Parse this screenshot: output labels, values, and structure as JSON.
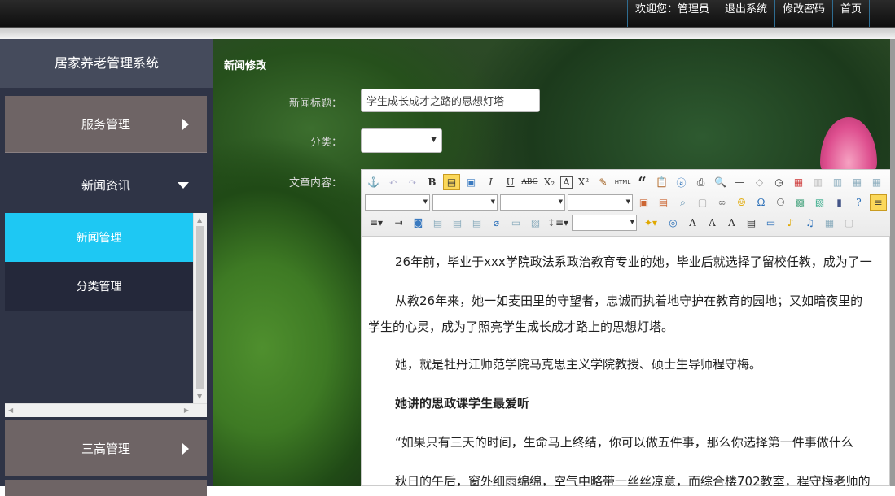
{
  "topnav": {
    "welcome": "欢迎您：管理员",
    "logout": "退出系统",
    "change_password": "修改密码",
    "home": "首页"
  },
  "sidebar": {
    "system_title": "居家养老管理系统",
    "menu": {
      "service": "服务管理",
      "news": "新闻资讯",
      "sanggao": "三高管理"
    },
    "submenu": {
      "news_manage": "新闻管理",
      "category_manage": "分类管理"
    }
  },
  "page": {
    "heading": "新闻修改"
  },
  "form": {
    "title_label": "新闻标题：",
    "title_value": "学生成长成才之路的思想灯塔——",
    "category_label": "分类：",
    "category_value": "",
    "content_label": "文章内容："
  },
  "editor": {
    "toolbar_icons_row1": [
      "anchor-icon",
      "undo-icon",
      "redo-icon",
      "bold-icon",
      "paste-plain-icon",
      "select-all-icon",
      "italic-icon",
      "underline-icon",
      "strikethrough-icon",
      "subscript-icon",
      "font-border-icon",
      "superscript-icon",
      "clear-format-icon",
      "html-icon",
      "blockquote-icon",
      "paste-text-icon",
      "word-paste-icon",
      "print-icon",
      "preview-icon",
      "horizontal-rule-icon",
      "eraser-icon",
      "time-icon",
      "date-icon",
      "table-row-icon",
      "table-col-icon",
      "insert-col-icon",
      "table-icon"
    ],
    "toolbar_icons_row2": [
      "font-family-select",
      "font-size-select",
      "paragraph-select",
      "line-height-select",
      "image-icon",
      "multi-image-icon",
      "search-replace-icon",
      "insert-link-icon",
      "unlink-icon",
      "emotion-icon",
      "special-char-icon",
      "map-icon",
      "gmap-icon",
      "insert-frame-icon",
      "video-icon",
      "help-icon",
      "justify-left-icon"
    ],
    "toolbar_icons_row3": [
      "list-ordered-icon",
      "indent-icon",
      "insert-frame2-icon",
      "align-left-icon",
      "align-center-icon",
      "align-right-icon",
      "attachment-icon",
      "page-break-icon",
      "background-icon",
      "row-spacing-icon",
      "custom-style-select",
      "format-brush-icon",
      "source-icon",
      "font-up-icon",
      "font-down-icon",
      "translate-icon",
      "template-icon",
      "snapshot-icon",
      "music-icon",
      "table-insert-icon",
      "copy-icon",
      "sort-icon"
    ],
    "paragraphs": [
      "26年前，毕业于xxx学院政法系政治教育专业的她，毕业后就选择了留校任教，成为了一",
      "从教26年来，她一如麦田里的守望者，忠诚而执着地守护在教育的园地；又如暗夜里的",
      "学生的心灵，成为了照亮学生成长成才路上的思想灯塔。",
      "她，就是牡丹江师范学院马克思主义学院教授、硕士生导师程守梅。",
      "她讲的思政课学生最爱听",
      "“如果只有三天的时间，生命马上终结，你可以做五件事，那么你选择第一件事做什么",
      "秋日的午后，窗外细雨绵绵，空气中略带一丝丝凉意，而综合楼702教室，程守梅老师的"
    ]
  },
  "colors": {
    "active_submenu": "#1ec8f3",
    "menu_bg": "#6e6465",
    "sidebar_bg": "#2f3446"
  }
}
